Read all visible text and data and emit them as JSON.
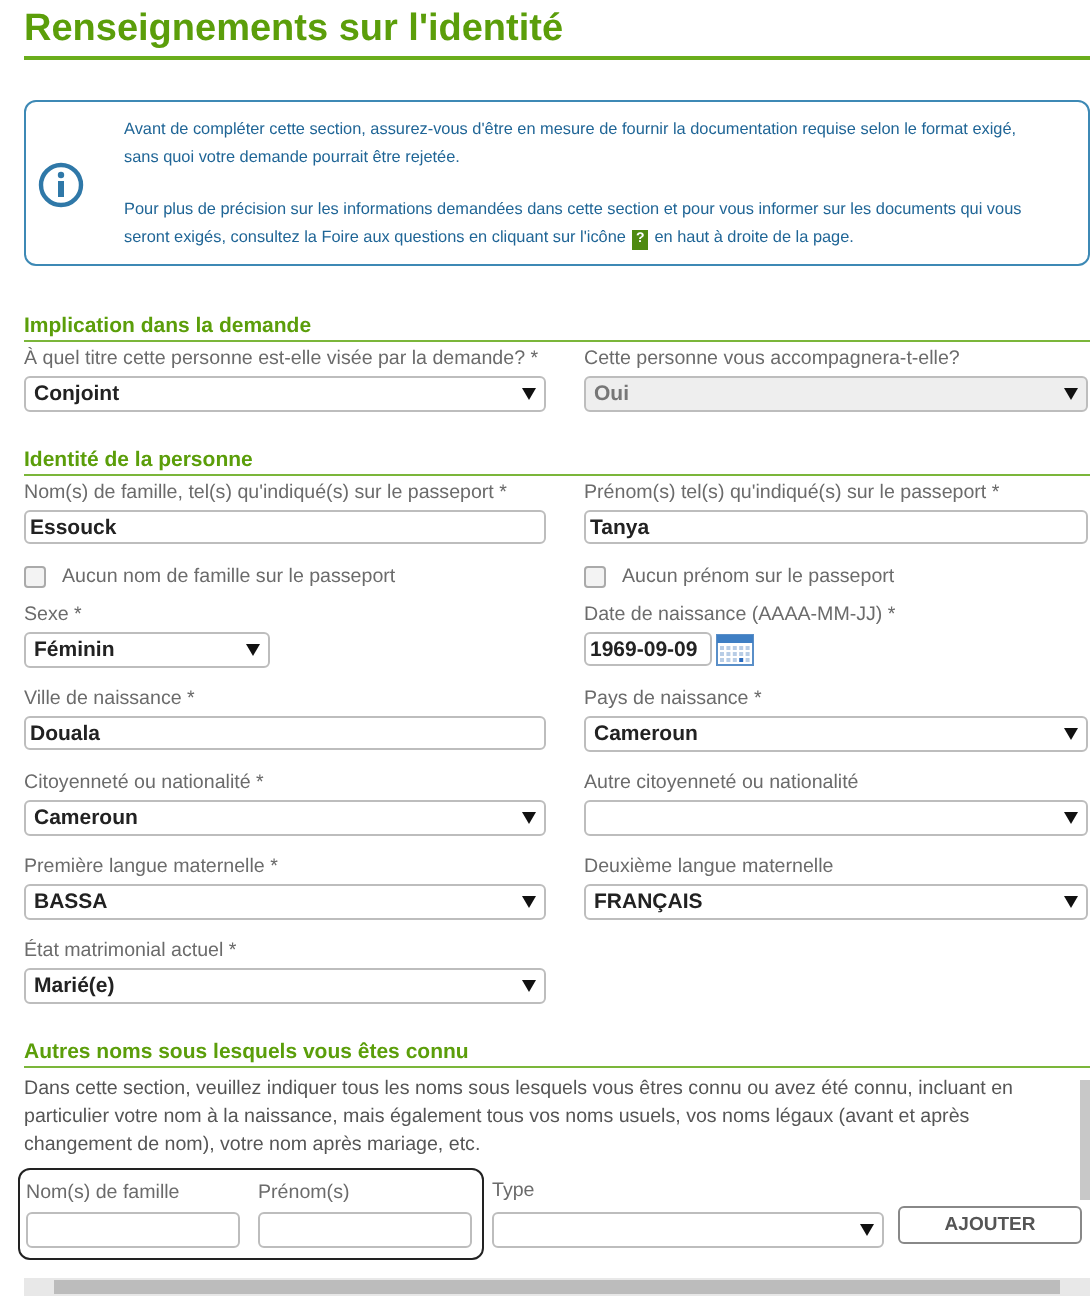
{
  "title": "Renseignements sur l'identité",
  "notice": {
    "paragraphs": [
      {
        "text": "Avant de compléter cette section, assurez-vous d'être en mesure de fournir la documentation requise selon le format exigé, sans quoi votre demande pourrait être rejetée."
      },
      {
        "text": "Pour plus de précision sur les informations demandées dans cette section et pour vous informer sur les documents qui vous seront exigés, consultez la Foire aux questions en cliquant sur l'icône",
        "badge": "?",
        "after": "en haut à droite de la page."
      }
    ]
  },
  "sections": [
    {
      "heading": "Implication dans la demande",
      "rows": [
        [
          {
            "kind": "select",
            "label": "À quel titre cette personne est-elle visée par la demande? *",
            "value": "Conjoint",
            "disabled": false
          },
          {
            "kind": "select",
            "label": "Cette personne vous accompagnera-t-elle?",
            "value": "Oui",
            "disabled": true
          }
        ]
      ]
    },
    {
      "heading": "Identité de la personne",
      "rows": [
        [
          {
            "kind": "text",
            "label": "Nom(s) de famille, tel(s) qu'indiqué(s) sur le passeport *",
            "value": "Essouck"
          },
          {
            "kind": "text",
            "label": "Prénom(s) tel(s) qu'indiqué(s) sur le passeport *",
            "value": "Tanya"
          }
        ],
        [
          {
            "kind": "checkbox",
            "label": "Aucun nom de famille sur le passeport",
            "checked": false
          },
          {
            "kind": "checkbox",
            "label": "Aucun prénom sur le passeport",
            "checked": false
          }
        ],
        [
          {
            "kind": "compact-select",
            "label": "Sexe *",
            "value": "Féminin",
            "disabled": false
          },
          {
            "kind": "date",
            "label": "Date de naissance (AAAA-MM-JJ) *",
            "value": "1969-09-09"
          }
        ],
        [
          {
            "kind": "text",
            "label": "Ville de naissance *",
            "value": "Douala"
          },
          {
            "kind": "select",
            "label": "Pays de naissance *",
            "value": "Cameroun",
            "disabled": false
          }
        ],
        [
          {
            "kind": "select",
            "label": "Citoyenneté ou nationalité *",
            "value": "Cameroun",
            "disabled": false
          },
          {
            "kind": "select",
            "label": "Autre citoyenneté ou nationalité",
            "disabled": false
          }
        ],
        [
          {
            "kind": "select",
            "label": "Première langue maternelle *",
            "value": "BASSA",
            "disabled": false
          },
          {
            "kind": "select",
            "label": "Deuxième langue maternelle",
            "value": "FRANÇAIS",
            "disabled": false
          }
        ],
        [
          {
            "kind": "select",
            "label": "État matrimonial actuel *",
            "value": "Marié(e)",
            "disabled": false
          }
        ]
      ]
    }
  ],
  "other_names": {
    "heading": "Autres noms sous lesquels vous êtes connu",
    "description": "Dans cette section, veuillez indiquer tous les noms sous lesquels vous êtres connu ou avez été connu, incluant en particulier votre nom à la naissance, mais également tous vos noms usuels, vos noms légaux (avant et après changement de nom), votre nom après mariage, etc.",
    "family_label": "Nom(s) de famille",
    "given_label": "Prénom(s)",
    "type_label": "Type",
    "button": "AJOUTER"
  }
}
